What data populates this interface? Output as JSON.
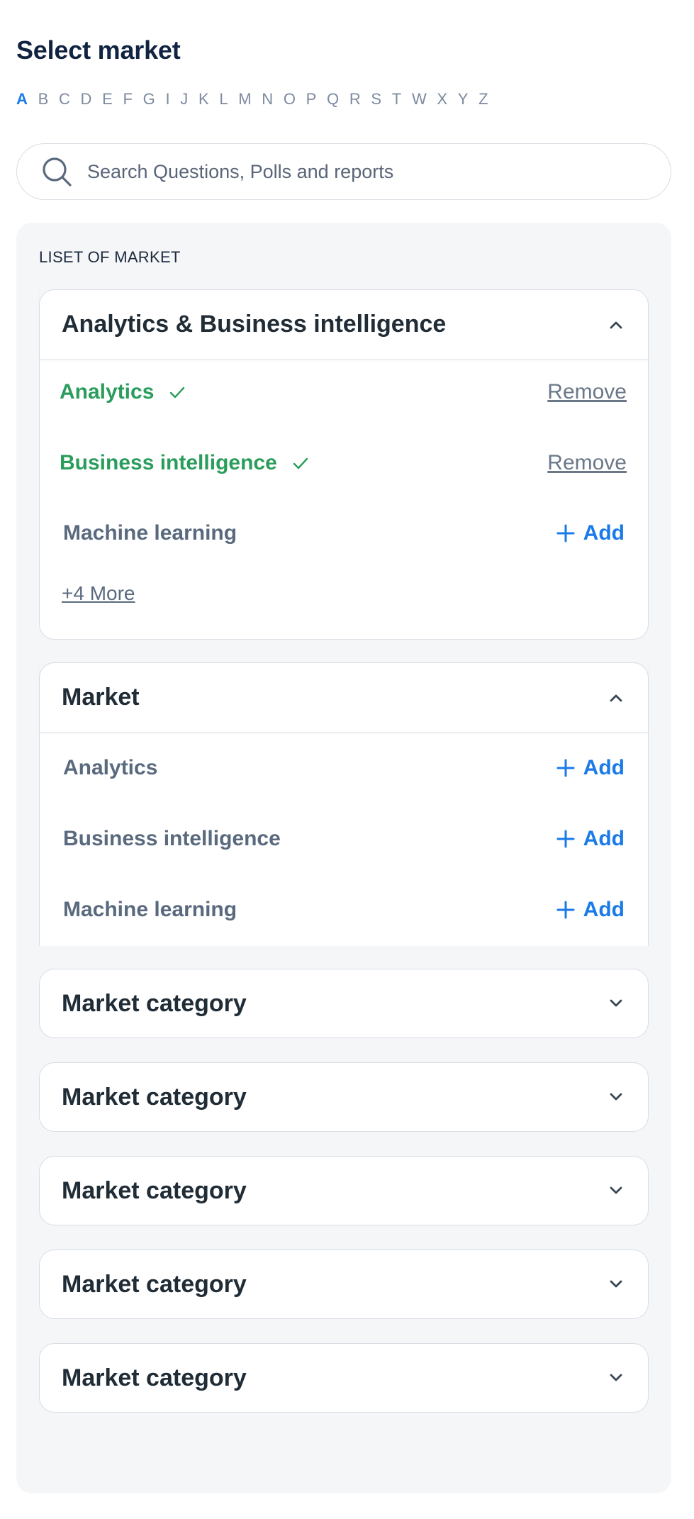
{
  "page": {
    "title": "Select market"
  },
  "alphabet": {
    "active": "A",
    "letters": [
      "A",
      "B",
      "C",
      "D",
      "E",
      "F",
      "G",
      "I",
      "J",
      "K",
      "L",
      "M",
      "N",
      "O",
      "P",
      "Q",
      "R",
      "S",
      "T",
      "W",
      "X",
      "Y",
      "Z"
    ]
  },
  "search": {
    "placeholder": "Search Questions, Polls and reports",
    "value": ""
  },
  "list": {
    "label": "LISET OF MARKET",
    "groups": [
      {
        "title": "Analytics & Business intelligence",
        "expanded": true,
        "items": [
          {
            "label": "Analytics",
            "selected": true,
            "action": "Remove"
          },
          {
            "label": "Business intelligence",
            "selected": true,
            "action": "Remove"
          },
          {
            "label": "Machine learning",
            "selected": false,
            "action": "Add"
          }
        ],
        "more": "+4 More"
      },
      {
        "title": "Market",
        "expanded": true,
        "items": [
          {
            "label": "Analytics",
            "selected": false,
            "action": "Add"
          },
          {
            "label": "Business intelligence",
            "selected": false,
            "action": "Add"
          },
          {
            "label": "Machine learning",
            "selected": false,
            "action": "Add"
          }
        ]
      },
      {
        "title": "Market category",
        "expanded": false
      },
      {
        "title": "Market category",
        "expanded": false
      },
      {
        "title": "Market category",
        "expanded": false
      },
      {
        "title": "Market category",
        "expanded": false
      },
      {
        "title": "Market category",
        "expanded": false
      }
    ]
  },
  "icons": {
    "search": "search-icon",
    "collapse": "chevron-up-icon",
    "expand": "chevron-down-icon",
    "selected": "check-icon",
    "add": "plus-icon"
  },
  "colors": {
    "accent": "#1a7ae8",
    "selected": "#2a9d5c",
    "heading": "#102341",
    "panel": "#f4f6f8"
  }
}
